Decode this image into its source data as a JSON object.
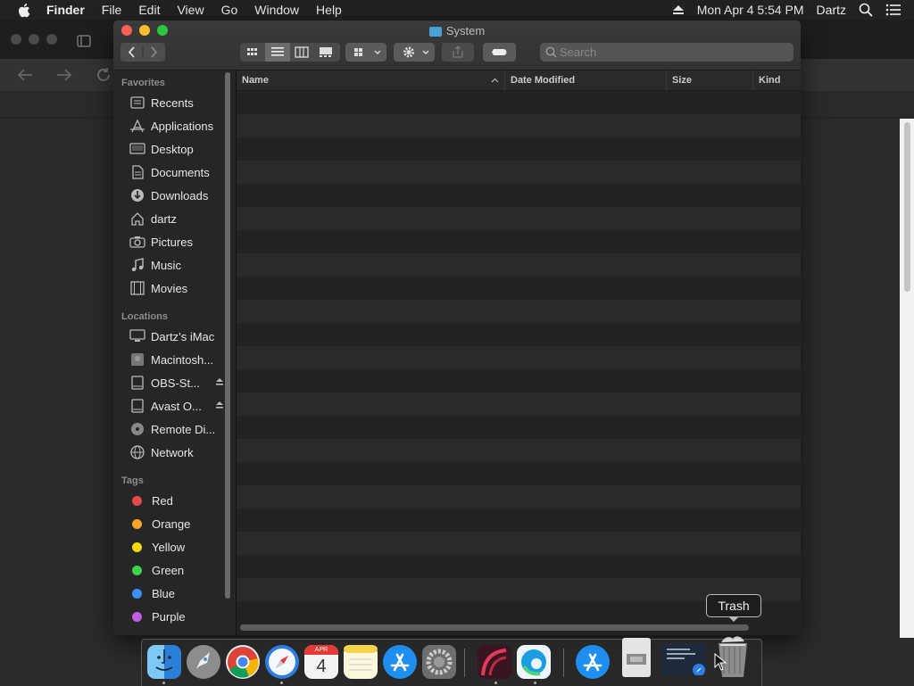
{
  "menubar": {
    "app_name": "Finder",
    "items": [
      "File",
      "Edit",
      "View",
      "Go",
      "Window",
      "Help"
    ],
    "clock": "Mon Apr 4  5:54 PM",
    "user": "Dartz"
  },
  "window": {
    "title": "System",
    "search_placeholder": "Search"
  },
  "sidebar": {
    "favorites_header": "Favorites",
    "favorites": [
      {
        "label": "Recents",
        "icon": "clock-icon"
      },
      {
        "label": "Applications",
        "icon": "applications-icon"
      },
      {
        "label": "Desktop",
        "icon": "desktop-icon"
      },
      {
        "label": "Documents",
        "icon": "document-icon"
      },
      {
        "label": "Downloads",
        "icon": "download-icon"
      },
      {
        "label": "dartz",
        "icon": "home-icon"
      },
      {
        "label": "Pictures",
        "icon": "camera-icon"
      },
      {
        "label": "Music",
        "icon": "music-note-icon"
      },
      {
        "label": "Movies",
        "icon": "film-icon"
      }
    ],
    "locations_header": "Locations",
    "locations": [
      {
        "label": "Dartz’s iMac",
        "icon": "imac-icon"
      },
      {
        "label": "Macintosh...",
        "icon": "hard-drive-icon"
      },
      {
        "label": "OBS-St...",
        "icon": "external-drive-icon"
      },
      {
        "label": "Avast O...",
        "icon": "external-drive-icon"
      },
      {
        "label": "Remote Di...",
        "icon": "disc-icon"
      },
      {
        "label": "Network",
        "icon": "globe-icon"
      }
    ],
    "tags_header": "Tags",
    "tags": [
      {
        "label": "Red",
        "color": "#e5484d"
      },
      {
        "label": "Orange",
        "color": "#f5a623"
      },
      {
        "label": "Yellow",
        "color": "#f5d90a"
      },
      {
        "label": "Green",
        "color": "#3dd44b"
      },
      {
        "label": "Blue",
        "color": "#3d8eff"
      },
      {
        "label": "Purple",
        "color": "#c15ee8"
      }
    ]
  },
  "columns": {
    "name": "Name",
    "date_modified": "Date Modified",
    "size": "Size",
    "kind": "Kind"
  },
  "dock": {
    "tooltip": "Trash",
    "apps": [
      {
        "name": "finder-icon",
        "color": "#3a8ee6"
      },
      {
        "name": "launchpad-icon",
        "color": "#8d8d8d"
      },
      {
        "name": "chrome-icon",
        "color": "#e8e8e8"
      },
      {
        "name": "safari-icon",
        "color": "#2f7de1"
      },
      {
        "name": "calendar-icon",
        "color": "#f4f4f4"
      },
      {
        "name": "notes-icon",
        "color": "#f7e27a"
      },
      {
        "name": "app-store-icon",
        "color": "#1e8ff0"
      },
      {
        "name": "system-preferences-icon",
        "color": "#777777"
      },
      {
        "name": "obs-icon",
        "color": "#4a1e2a"
      },
      {
        "name": "edge-icon",
        "color": "#1b9de2"
      },
      {
        "name": "app-store-downloads-icon",
        "color": "#1e8ff0"
      },
      {
        "name": "document-stack-icon",
        "color": "#dcdcdc"
      },
      {
        "name": "screenshot-thumbnail-icon",
        "color": "#1d2a3a"
      },
      {
        "name": "trash-icon",
        "color": "#9c9c9c"
      }
    ],
    "calendar_month": "APR",
    "calendar_day": "4"
  },
  "colors": {
    "close": "#fe5f57",
    "minimize": "#febc2e",
    "zoom": "#28c840"
  }
}
